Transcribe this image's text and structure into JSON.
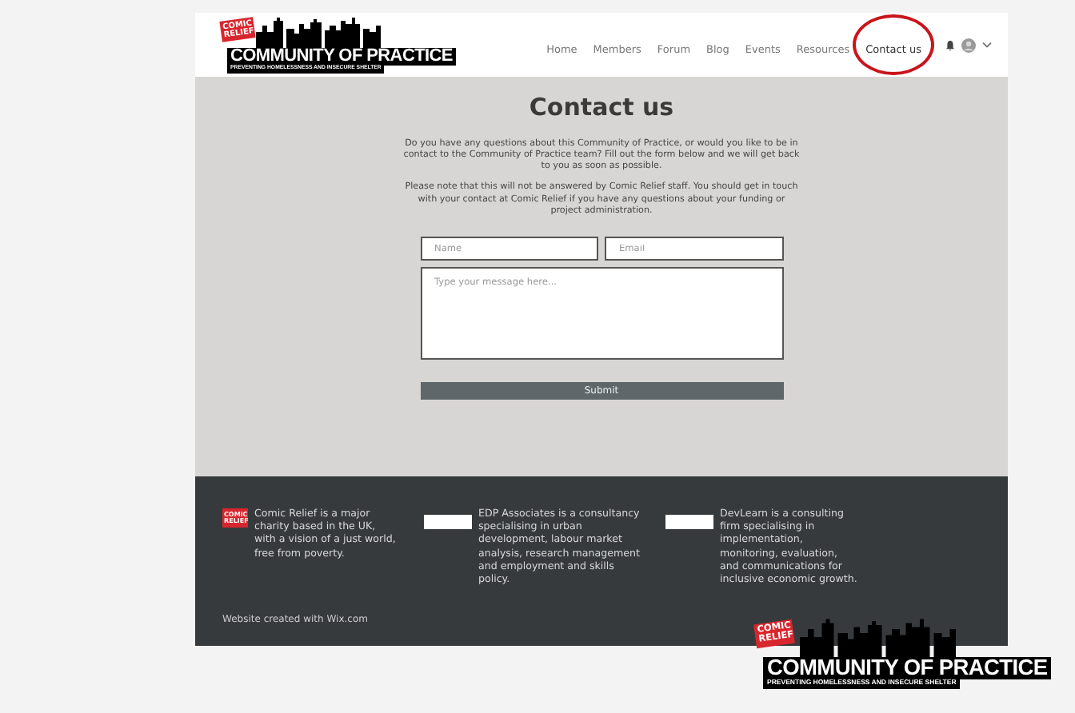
{
  "header": {
    "logo": {
      "badge": "COMIC RELIEF",
      "title": "COMMUNITY OF PRACTICE",
      "subtitle": "PREVENTING HOMELESSNESS AND INSECURE SHELTER"
    },
    "nav": [
      {
        "label": "Home",
        "selected": false
      },
      {
        "label": "Members",
        "selected": false
      },
      {
        "label": "Forum",
        "selected": false
      },
      {
        "label": "Blog",
        "selected": false
      },
      {
        "label": "Events",
        "selected": false
      },
      {
        "label": "Resources",
        "selected": false
      },
      {
        "label": "Contact us",
        "selected": true
      }
    ]
  },
  "main": {
    "title": "Contact us",
    "paragraphs": [
      "Do you have any questions about this Community of Practice, or would you like to be in contact to the Community of Practice team? Fill out the form below and we will get back to you as soon as possible.",
      "Please note that this will not be answered by Comic Relief staff. You should  get in touch with your contact at Comic Relief if you have any questions about your funding or project administration."
    ],
    "form": {
      "name": {
        "placeholder": "Name"
      },
      "email": {
        "placeholder": "Email"
      },
      "message": {
        "placeholder": "Type your message here..."
      },
      "submit": "Submit"
    }
  },
  "footer": {
    "partners": [
      {
        "kind": "badge",
        "logo_text": "COMIC RELIEF",
        "text": "Comic Relief is a major charity based in the UK, with a vision of a just world, free from poverty."
      },
      {
        "kind": "plain",
        "text": "EDP Associates is a consultancy specialising in urban development, labour market analysis, research management and employment and skills policy."
      },
      {
        "kind": "plain",
        "text": "DevLearn is a consulting firm specialising in implementation, monitoring, evaluation, and communications for inclusive economic growth."
      }
    ],
    "credit": "Website created with Wix.com"
  },
  "corner_logo": {
    "badge": "COMIC RELIEF",
    "title": "COMMUNITY OF PRACTICE",
    "subtitle": "PREVENTING HOMELESSNESS AND INSECURE SHELTER"
  }
}
